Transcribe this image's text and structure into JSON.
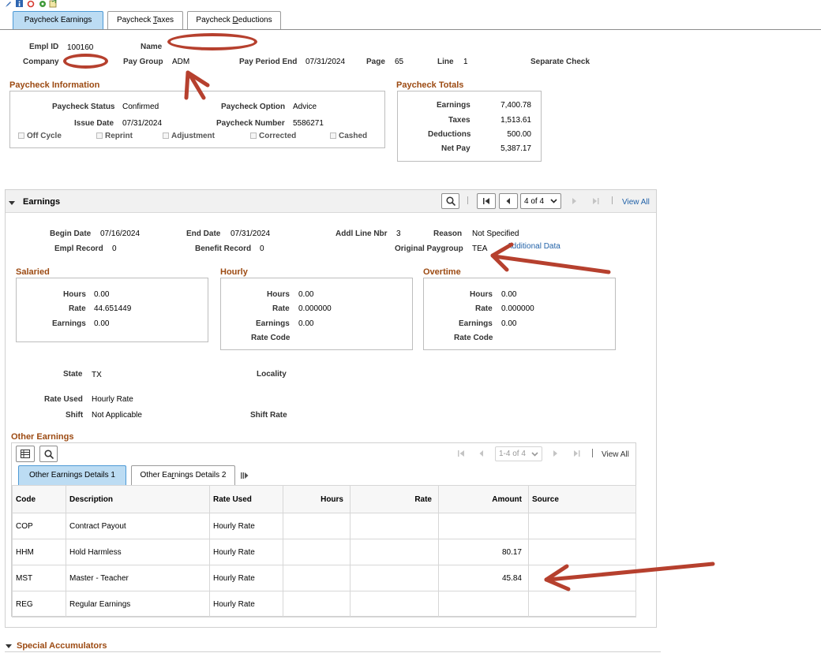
{
  "toolbar_icons": [
    "edit-icon",
    "info-icon",
    "refresh-icon",
    "settings-icon",
    "notes-icon"
  ],
  "tabs": [
    {
      "label": "Paycheck Earnings"
    },
    {
      "label_pre": "Paycheck ",
      "label_u": "T",
      "label_post": "axes"
    },
    {
      "label_pre": "Paycheck ",
      "label_u": "D",
      "label_post": "eductions"
    }
  ],
  "header": {
    "empl_id_label": "Empl ID",
    "empl_id": "100160",
    "name_label": "Name",
    "company_label": "Company",
    "pay_group_label": "Pay Group",
    "pay_group": "ADM",
    "pay_period_end_label": "Pay Period End",
    "pay_period_end": "07/31/2024",
    "page_label": "Page",
    "page": "65",
    "line_label": "Line",
    "line": "1",
    "separate_check": "Separate Check"
  },
  "paycheck_info": {
    "title": "Paycheck Information",
    "status_label": "Paycheck Status",
    "status": "Confirmed",
    "option_label": "Paycheck Option",
    "option": "Advice",
    "issue_date_label": "Issue Date",
    "issue_date": "07/31/2024",
    "number_label": "Paycheck Number",
    "number": "5586271",
    "checkboxes": [
      "Off Cycle",
      "Reprint",
      "Adjustment",
      "Corrected",
      "Cashed"
    ]
  },
  "paycheck_totals": {
    "title": "Paycheck Totals",
    "earnings_label": "Earnings",
    "earnings": "7,400.78",
    "taxes_label": "Taxes",
    "taxes": "1,513.61",
    "deductions_label": "Deductions",
    "deductions": "500.00",
    "net_pay_label": "Net Pay",
    "net_pay": "5,387.17"
  },
  "earnings": {
    "title": "Earnings",
    "pager": "4 of 4",
    "view_all": "View All",
    "begin_date_label": "Begin Date",
    "begin_date": "07/16/2024",
    "end_date_label": "End Date",
    "end_date": "07/31/2024",
    "addl_line_label": "Addl Line Nbr",
    "addl_line": "3",
    "reason_label": "Reason",
    "reason": "Not Specified",
    "empl_record_label": "Empl Record",
    "empl_record": "0",
    "benefit_record_label": "Benefit Record",
    "benefit_record": "0",
    "orig_paygroup_label": "Original Paygroup",
    "orig_paygroup": "TEA",
    "additional_data": "Additional Data",
    "salaried": {
      "title": "Salaried",
      "hours_label": "Hours",
      "hours": "0.00",
      "rate_label": "Rate",
      "rate": "44.651449",
      "earnings_label": "Earnings",
      "earnings": "0.00"
    },
    "hourly": {
      "title": "Hourly",
      "hours_label": "Hours",
      "hours": "0.00",
      "rate_label": "Rate",
      "rate": "0.000000",
      "earnings_label": "Earnings",
      "earnings": "0.00",
      "rate_code_label": "Rate Code"
    },
    "overtime": {
      "title": "Overtime",
      "hours_label": "Hours",
      "hours": "0.00",
      "rate_label": "Rate",
      "rate": "0.000000",
      "earnings_label": "Earnings",
      "earnings": "0.00",
      "rate_code_label": "Rate Code"
    },
    "state_label": "State",
    "state": "TX",
    "locality_label": "Locality",
    "rate_used_label": "Rate Used",
    "rate_used": "Hourly Rate",
    "shift_label": "Shift",
    "shift": "Not Applicable",
    "shift_rate_label": "Shift Rate"
  },
  "other_earnings": {
    "title": "Other Earnings",
    "pager": "1-4 of 4",
    "view_all": "View All",
    "tab1": "Other Earnings Details 1",
    "tab2_pre": "Other Ea",
    "tab2_u": "r",
    "tab2_post": "nings Details 2",
    "columns": [
      "Code",
      "Description",
      "Rate Used",
      "Hours",
      "Rate",
      "Amount",
      "Source"
    ],
    "rows": [
      {
        "code": "COP",
        "description": "Contract Payout",
        "rate_used": "Hourly Rate",
        "hours": "",
        "rate": "",
        "amount": "",
        "source": ""
      },
      {
        "code": "HHM",
        "description": "Hold Harmless",
        "rate_used": "Hourly Rate",
        "hours": "",
        "rate": "",
        "amount": "80.17",
        "source": ""
      },
      {
        "code": "MST",
        "description": "Master - Teacher",
        "rate_used": "Hourly Rate",
        "hours": "",
        "rate": "",
        "amount": "45.84",
        "source": ""
      },
      {
        "code": "REG",
        "description": "Regular Earnings",
        "rate_used": "Hourly Rate",
        "hours": "",
        "rate": "",
        "amount": "",
        "source": ""
      }
    ]
  },
  "special_accumulators": {
    "title": "Special Accumulators"
  },
  "colors": {
    "section_title": "#9c4a12",
    "active_tab": "#bcdcf3",
    "annotation": "#b6402e",
    "link": "#2262a8"
  }
}
